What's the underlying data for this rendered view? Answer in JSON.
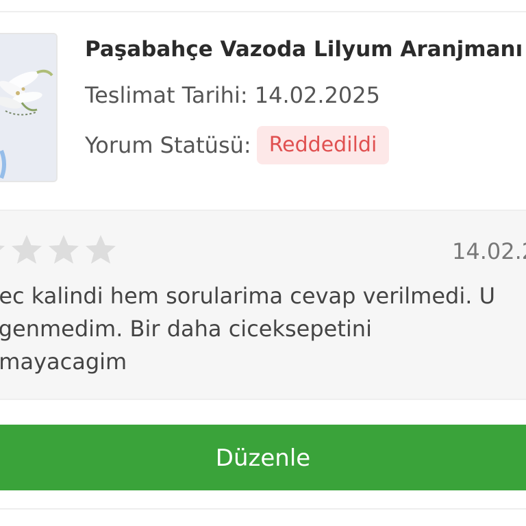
{
  "product": {
    "title": "Paşabahçe Vazoda Lilyum Aranjmanı",
    "delivery_label": "Teslimat Tarihi:",
    "delivery_date": "14.02.2025",
    "status_label": "Yorum Statüsü:",
    "status_value": "Reddedildi"
  },
  "review": {
    "date": "14.02.2",
    "text_lines": [
      "gec kalindi hem sorularima cevap verilmedi. U",
      "egenmedim. Bir daha ciceksepetini",
      "nmayacagim"
    ],
    "visible_star_count": 3
  },
  "actions": {
    "edit_label": "Düzenle"
  },
  "colors": {
    "status_bg": "#fde8e8",
    "status_text": "#e05050",
    "button_bg": "#3aa33a",
    "star": "#dddddd"
  }
}
